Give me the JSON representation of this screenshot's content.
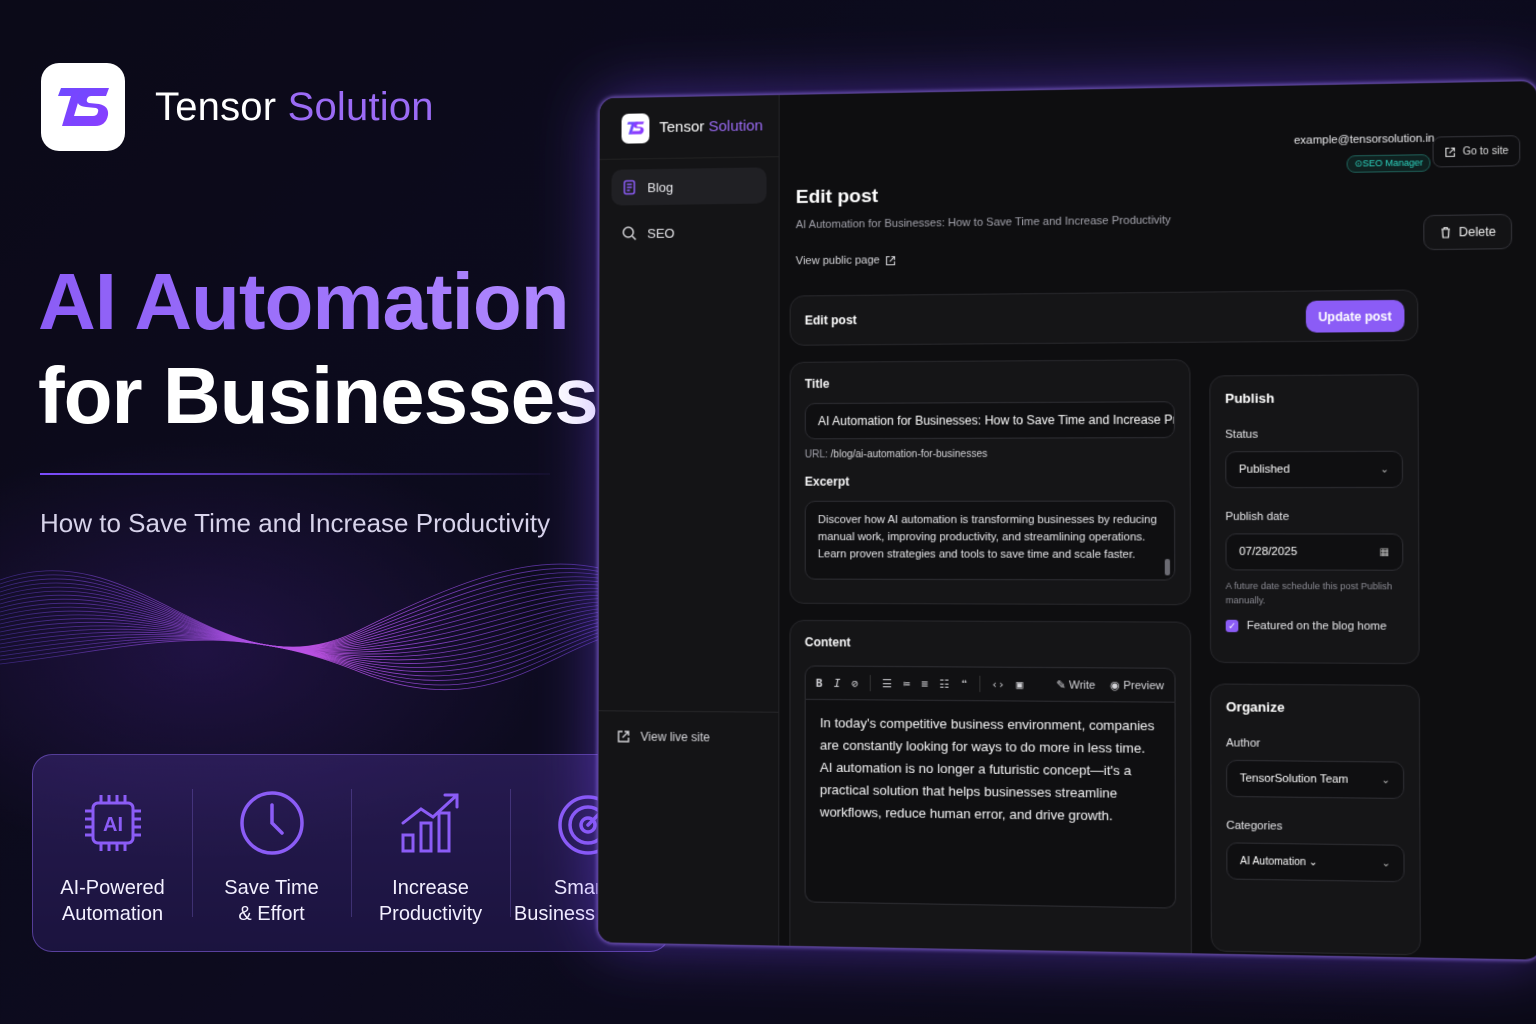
{
  "brand": {
    "name_primary": "Tensor",
    "name_accent": "Solution",
    "logo_text": "TS"
  },
  "hero": {
    "title_line1": "AI Automation",
    "title_line2": "for Businesses",
    "subtitle": "How to Save Time and Increase Productivity"
  },
  "features": [
    {
      "icon": "ai-chip-icon",
      "label": "AI-Powered\nAutomation"
    },
    {
      "icon": "clock-icon",
      "label": "Save Time\n& Effort"
    },
    {
      "icon": "growth-chart-icon",
      "label": "Increase\nProductivity"
    },
    {
      "icon": "target-icon",
      "label": "Smarter\nBusiness Growth"
    }
  ],
  "app": {
    "sidebar": {
      "brand_primary": "Tensor",
      "brand_accent": "Solution",
      "items": [
        {
          "label": "Blog",
          "icon": "blog-icon",
          "active": true
        },
        {
          "label": "SEO",
          "icon": "search-icon",
          "active": false
        }
      ],
      "footer_link": "View live site"
    },
    "topbar": {
      "user_email": "example@tensorsolution.in",
      "role_badge": "SEO Manager",
      "go_to_site": "Go to site"
    },
    "page": {
      "title": "Edit post",
      "subtitle": "AI Automation for Businesses: How to Save Time and Increase Productivity",
      "view_public": "View public page",
      "delete_label": "Delete"
    },
    "edit_bar": {
      "label": "Edit post",
      "update_button": "Update post"
    },
    "post": {
      "title_label": "Title",
      "title_value": "AI Automation for Businesses: How to Save Time and Increase Pro",
      "url_prefix": "URL:",
      "url_value": "/blog/ai-automation-for-businesses",
      "excerpt_label": "Excerpt",
      "excerpt_value": "Discover how AI automation is transforming businesses by reducing manual work, improving productivity, and streamlining operations. Learn proven strategies and tools to save time and scale faster.",
      "content_label": "Content",
      "toolbar": {
        "bold": "B",
        "italic": "I",
        "write": "Write",
        "preview": "Preview"
      },
      "content_value": "In today's competitive business environment, companies are constantly looking for ways to do more in less time. AI automation is no longer a futuristic concept—it's a practical solution that helps businesses streamline workflows, reduce human error, and drive growth."
    },
    "publish": {
      "heading": "Publish",
      "status_label": "Status",
      "status_value": "Published",
      "date_label": "Publish date",
      "date_value": "07/28/2025",
      "date_hint": "A future date schedule this post Publish manually.",
      "featured_label": "Featured on the blog home",
      "featured_checked": true
    },
    "organize": {
      "heading": "Organize",
      "author_label": "Author",
      "author_value": "TensorSolution Team",
      "categories_label": "Categories",
      "category_value": "AI Automation"
    }
  },
  "colors": {
    "accent": "#8b5cf6",
    "accent_light": "#9b6bf5",
    "badge_teal": "#2dd4bf",
    "background": "#0b0a18"
  }
}
